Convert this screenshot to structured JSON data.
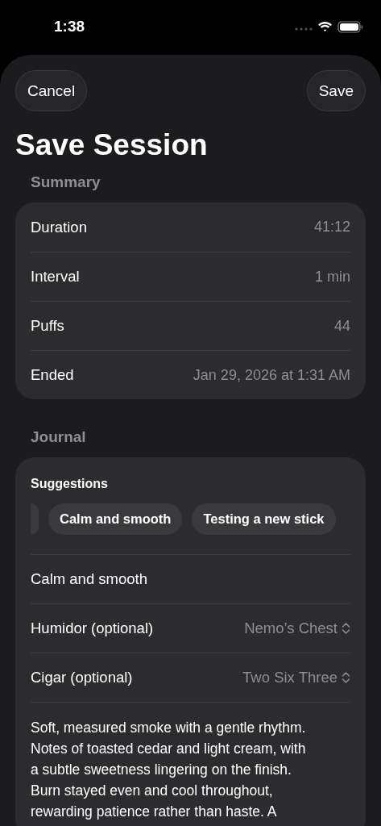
{
  "status_bar": {
    "time": "1:38"
  },
  "nav": {
    "cancel": "Cancel",
    "save": "Save"
  },
  "title": "Save Session",
  "summary": {
    "header": "Summary",
    "rows": [
      {
        "label": "Duration",
        "value": "41:12"
      },
      {
        "label": "Interval",
        "value": "1 min"
      },
      {
        "label": "Puffs",
        "value": "44"
      },
      {
        "label": "Ended",
        "value": "Jan 29, 2026 at 1:31 AM"
      }
    ]
  },
  "journal": {
    "header": "Journal",
    "suggestions": {
      "title": "Suggestions",
      "leading_chip_clipped": true,
      "chips": [
        {
          "label": "Calm and smooth"
        },
        {
          "label": "Testing a new stick"
        }
      ]
    },
    "entry_title": "Calm and smooth",
    "pickers": [
      {
        "label": "Humidor (optional)",
        "value": "Nemo’s Chest"
      },
      {
        "label": "Cigar (optional)",
        "value": "Two Six Three"
      }
    ],
    "note": "Soft, measured smoke with a gentle rhythm.\nNotes of toasted cedar and light cream, with\na subtle sweetness lingering on the finish.\nBurn stayed even and cool throughout,\nrewarding patience rather than haste. A"
  }
}
